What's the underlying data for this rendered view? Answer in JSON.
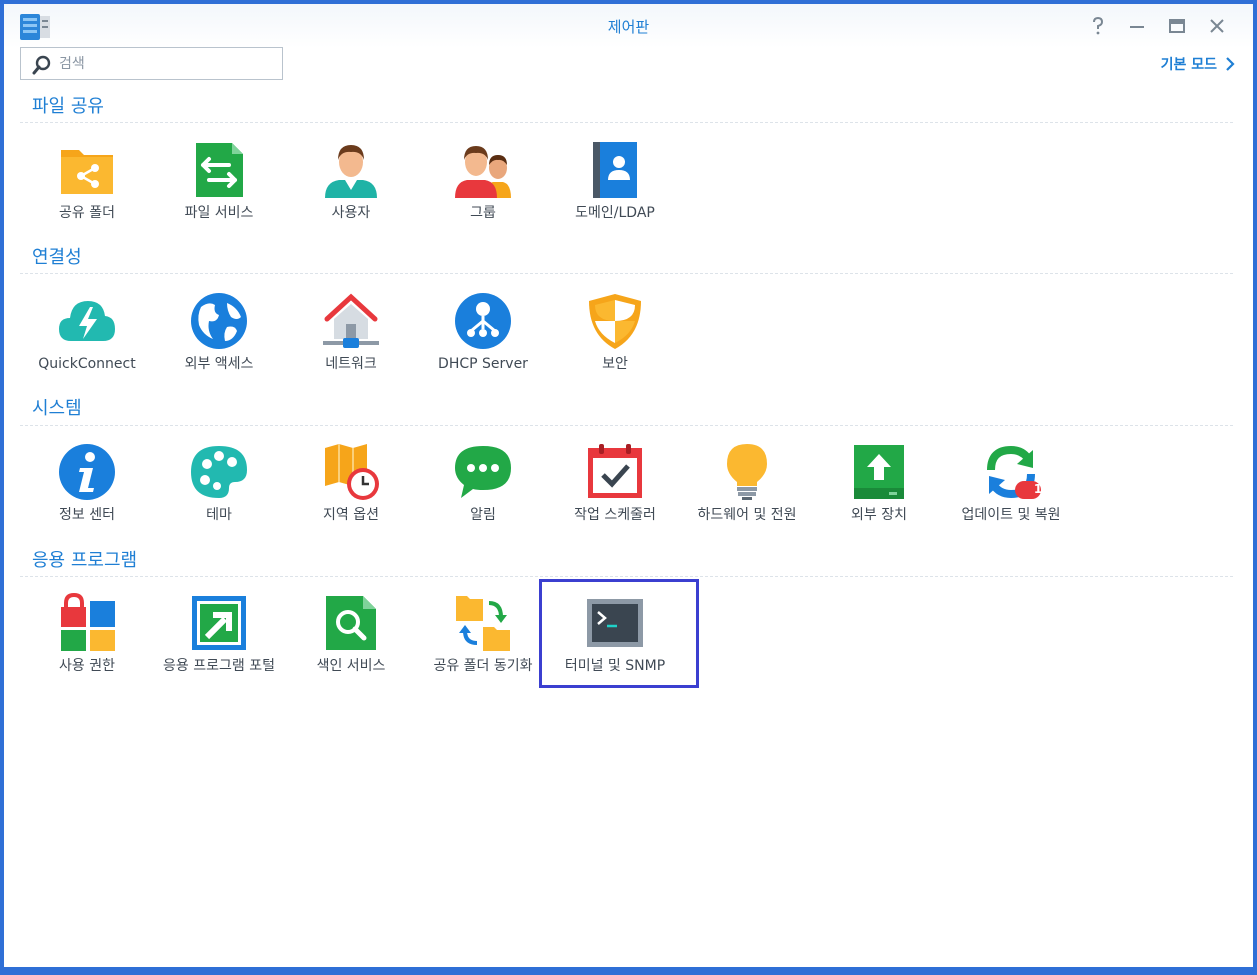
{
  "window": {
    "title": "제어판"
  },
  "search": {
    "placeholder": "검색"
  },
  "header": {
    "mode_link": "기본 모드"
  },
  "sections": [
    {
      "title": "파일 공유",
      "items": [
        {
          "label": "공유 폴더",
          "icon": "shared-folder-icon"
        },
        {
          "label": "파일 서비스",
          "icon": "file-services-icon"
        },
        {
          "label": "사용자",
          "icon": "user-icon"
        },
        {
          "label": "그룹",
          "icon": "group-icon"
        },
        {
          "label": "도메인/LDAP",
          "icon": "domain-ldap-icon"
        }
      ]
    },
    {
      "title": "연결성",
      "items": [
        {
          "label": "QuickConnect",
          "icon": "quickconnect-icon"
        },
        {
          "label": "외부 액세스",
          "icon": "external-access-icon"
        },
        {
          "label": "네트워크",
          "icon": "network-icon"
        },
        {
          "label": "DHCP Server",
          "icon": "dhcp-server-icon"
        },
        {
          "label": "보안",
          "icon": "security-shield-icon"
        }
      ]
    },
    {
      "title": "시스템",
      "items": [
        {
          "label": "정보 센터",
          "icon": "info-center-icon"
        },
        {
          "label": "테마",
          "icon": "theme-palette-icon"
        },
        {
          "label": "지역 옵션",
          "icon": "regional-options-icon"
        },
        {
          "label": "알림",
          "icon": "notification-icon"
        },
        {
          "label": "작업 스케줄러",
          "icon": "task-scheduler-icon"
        },
        {
          "label": "하드웨어 및 전원",
          "icon": "hardware-power-icon"
        },
        {
          "label": "외부 장치",
          "icon": "external-devices-icon"
        },
        {
          "label": "업데이트 및 복원",
          "icon": "update-restore-icon",
          "badge": "1"
        }
      ]
    },
    {
      "title": "응용 프로그램",
      "items": [
        {
          "label": "사용 권한",
          "icon": "privileges-icon"
        },
        {
          "label": "응용 프로그램 포털",
          "icon": "application-portal-icon"
        },
        {
          "label": "색인 서비스",
          "icon": "indexing-service-icon"
        },
        {
          "label": "공유 폴더 동기화",
          "icon": "shared-folder-sync-icon"
        },
        {
          "label": "터미널 및 SNMP",
          "icon": "terminal-snmp-icon"
        }
      ]
    }
  ],
  "colors": {
    "accent": "#1f7fd4",
    "highlight": "#3b3fd0"
  }
}
